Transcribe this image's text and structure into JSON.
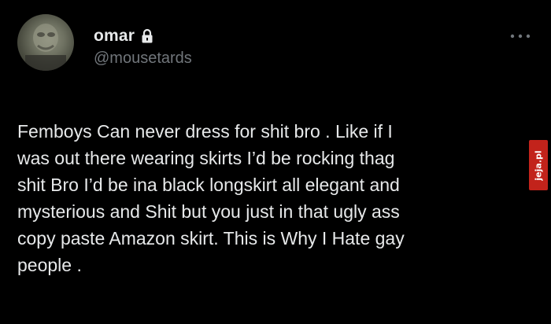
{
  "tweet": {
    "author": {
      "display_name": "omar",
      "handle": "@mousetards",
      "avatar_icon": "avatar-image",
      "protected_icon": "lock-icon"
    },
    "more_icon": "more-options-icon",
    "text": "Femboys Can never dress for shit bro . Like if I\nwas out there wearing skirts I’d be rocking thag\nshit Bro I’d be ina black longskirt all elegant and\nmysterious and Shit but you just in that ugly ass\ncopy paste Amazon skirt. This is Why I Hate gay\npeople ."
  },
  "watermark": {
    "text": "jeja.pl",
    "color": "#c2231b"
  },
  "colors": {
    "background": "#000000",
    "primary_text": "#e7e9ea",
    "secondary_text": "#71767b"
  }
}
